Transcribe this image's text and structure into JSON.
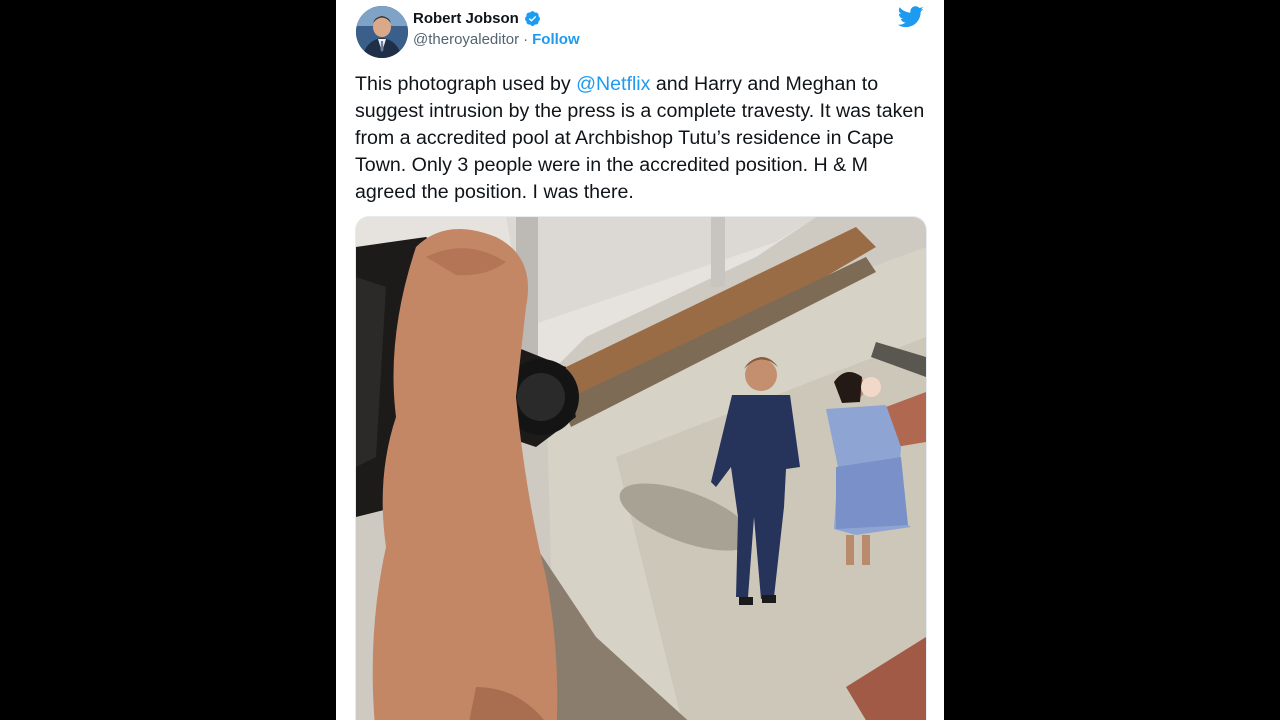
{
  "author": {
    "name": "Robert Jobson",
    "handle": "@theroyaleditor",
    "separator": "·",
    "follow_label": "Follow"
  },
  "tweet": {
    "text_before": "This photograph used by ",
    "mention": "@Netflix",
    "text_after": " and Harry and Meghan to suggest intrusion by the press is a complete travesty. It was taken from a accredited pool at Archbishop Tutu’s residence in Cape Town. Only 3 people were in the accredited position. H & M agreed the position. I was there."
  },
  "colors": {
    "accent": "#1d9bf0",
    "text": "#0f1419",
    "secondary": "#536471",
    "background": "#000000"
  },
  "icons": {
    "verified": "verified-badge-icon",
    "brand": "twitter-bird-icon"
  }
}
